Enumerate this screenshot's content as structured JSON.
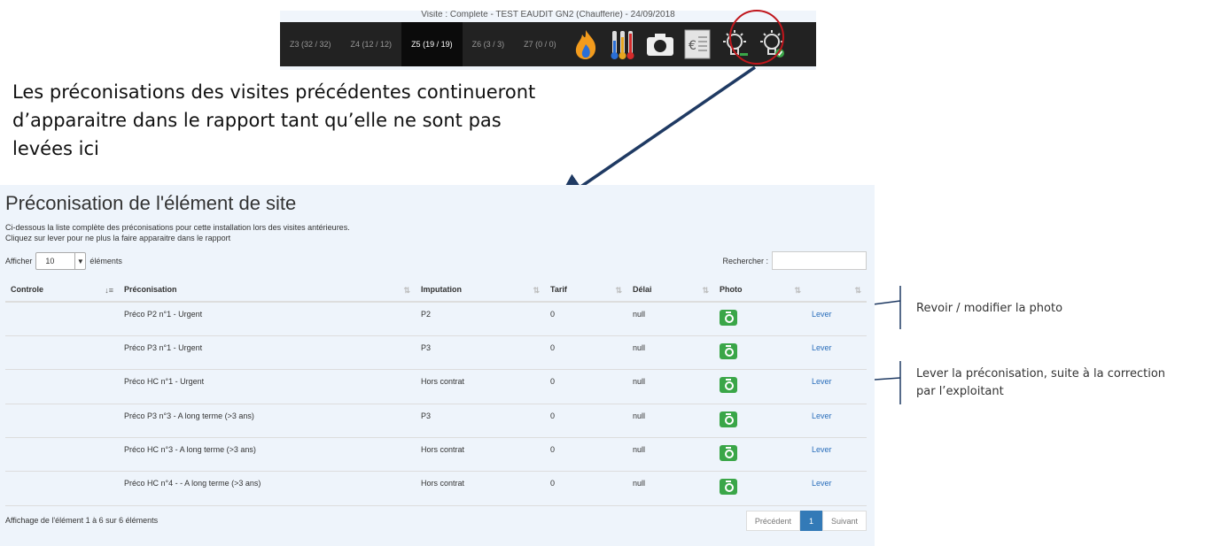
{
  "header": {
    "title": "Visite : Complete - TEST EAUDIT GN2 (Chaufferie) - 24/09/2018",
    "tabs": [
      "Z3 (32 / 32)",
      "Z4 (12 / 12)",
      "Z5 (19 / 19)",
      "Z6 (3 / 3)",
      "Z7 (0 / 0)"
    ],
    "active_tab": "Z5 (19 / 19)"
  },
  "annotations": {
    "main": "Les préconisations des visites précédentes continueront d’apparaitre dans le rapport tant qu’elle ne sont pas levées ici",
    "photo_note": "Revoir / modifier la photo",
    "lever_note_line1": "Lever la préconisation, suite à la correction",
    "lever_note_line2": "par l’exploitant"
  },
  "panel": {
    "title": "Préconisation de l'élément de site",
    "desc_line1": "Ci-dessous la liste complète des préconisations pour cette installation lors des visites antérieures.",
    "desc_line2": "Cliquez sur lever pour ne plus la faire apparaitre dans le rapport",
    "show_label": "Afficher",
    "show_value": "10",
    "show_suffix": "éléments",
    "search_label": "Rechercher :",
    "columns": [
      "Controle",
      "Préconisation",
      "Imputation",
      "Tarif",
      "Délai",
      "Photo",
      ""
    ],
    "rows": [
      {
        "controle": "",
        "preco": "Préco P2 n°1 - Urgent",
        "imputation": "P2",
        "tarif": "0",
        "delai": "null",
        "action": "Lever"
      },
      {
        "controle": "",
        "preco": "Préco P3 n°1 - Urgent",
        "imputation": "P3",
        "tarif": "0",
        "delai": "null",
        "action": "Lever"
      },
      {
        "controle": "",
        "preco": "Préco HC n°1 - Urgent",
        "imputation": "Hors contrat",
        "tarif": "0",
        "delai": "null",
        "action": "Lever"
      },
      {
        "controle": "",
        "preco": "Préco P3 n°3 - A long terme (>3 ans)",
        "imputation": "P3",
        "tarif": "0",
        "delai": "null",
        "action": "Lever"
      },
      {
        "controle": "",
        "preco": "Préco HC n°3 - A long terme (>3 ans)",
        "imputation": "Hors contrat",
        "tarif": "0",
        "delai": "null",
        "action": "Lever"
      },
      {
        "controle": "",
        "preco": "Préco HC n°4 - - A long terme (>3 ans)",
        "imputation": "Hors contrat",
        "tarif": "0",
        "delai": "null",
        "action": "Lever"
      }
    ],
    "info": "Affichage de l'élément 1 à 6 sur 6 éléments",
    "pager": {
      "prev": "Précédent",
      "current": "1",
      "next": "Suivant"
    }
  },
  "colors": {
    "camera": "#3aa648",
    "link": "#2a6ebb",
    "highlight_circle": "#c0161c",
    "arrow": "#1f3a63"
  }
}
